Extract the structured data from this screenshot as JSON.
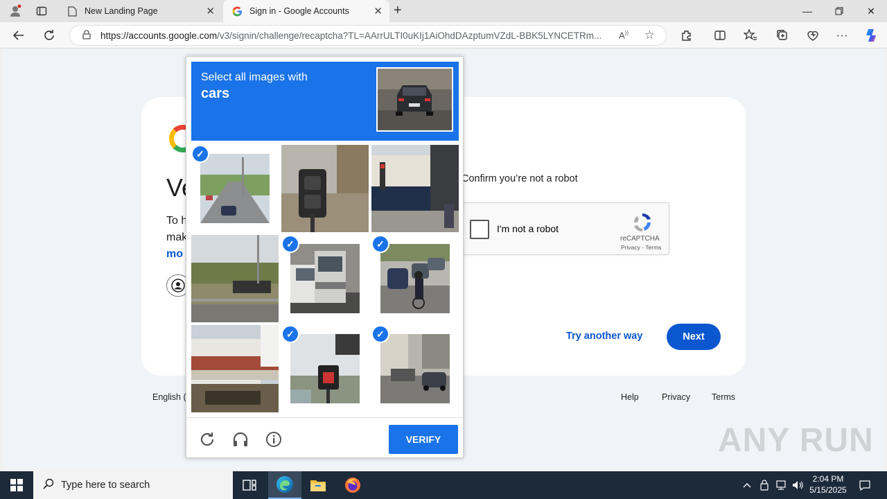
{
  "browser": {
    "tabs": [
      {
        "label": "New Landing Page"
      },
      {
        "label": "Sign in - Google Accounts"
      }
    ],
    "url_host": "https://accounts.google.com",
    "url_path": "/v3/signin/challenge/recaptcha?TL=AArrULTI0uKIj1AiOhdDAzptumVZdL-BBK5LYNCETRm..."
  },
  "signin": {
    "heading": "Ve",
    "para_line1": "To h",
    "para_line2": "mak",
    "more_link": "mo",
    "confirm_text": "Confirm you’re not a robot",
    "checkbox_label": "I'm not a robot",
    "recaptcha_name": "reCAPTCHA",
    "recaptcha_links": "Privacy - Terms",
    "try_another": "Try another way",
    "next_label": "Next",
    "footer_lang": "English (",
    "footer_links": [
      "Help",
      "Privacy",
      "Terms"
    ]
  },
  "challenge": {
    "instruction": "Select all images with",
    "target": "cars",
    "verify_label": "VERIFY",
    "tiles_selected": [
      true,
      false,
      false,
      false,
      true,
      true,
      false,
      true,
      true
    ]
  },
  "taskbar": {
    "search_placeholder": "Type here to search",
    "time": "2:04 PM",
    "date": "5/15/2025"
  },
  "watermark": "ANY RUN",
  "colors": {
    "captcha_blue": "#1a73e8",
    "google_blue": "#0b57d0"
  }
}
